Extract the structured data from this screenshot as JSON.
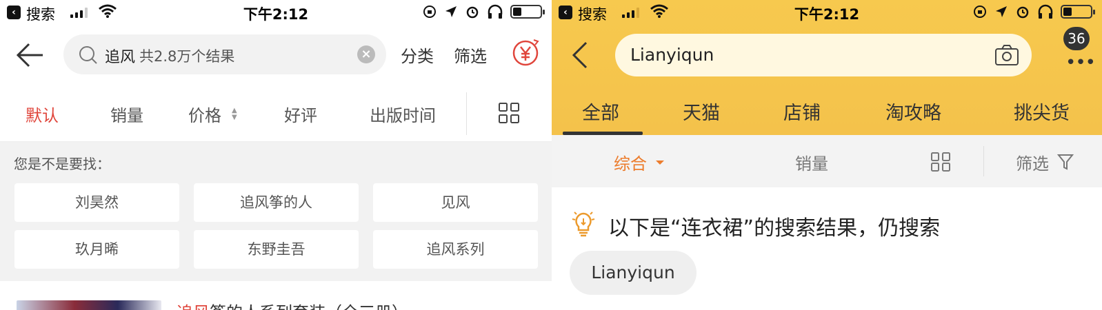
{
  "left": {
    "status_bar": {
      "carrier": "搜索",
      "time": "下午2:12"
    },
    "search": {
      "query": "追风",
      "count_text": "共2.8万个结果",
      "clear_icon": "clear-icon"
    },
    "header_actions": {
      "category": "分类",
      "filter": "筛选",
      "coupon_icon": "yen-coupon-icon"
    },
    "sort_tabs": [
      {
        "label": "默认",
        "active": true
      },
      {
        "label": "销量",
        "active": false
      },
      {
        "label": "价格",
        "active": false
      },
      {
        "label": "好评",
        "active": false
      },
      {
        "label": "出版时间",
        "active": false
      }
    ],
    "suggestions": {
      "hint": "您是不是要找：",
      "items": [
        "刘昊然",
        "追风筝的人",
        "见风",
        "玖月晞",
        "东野圭吾",
        "追风系列"
      ]
    },
    "result": {
      "highlight": "追风",
      "title_rest": "筝的人系列套装（全三册）"
    },
    "accent_color": "#e0463c"
  },
  "right": {
    "status_bar": {
      "carrier": "搜索",
      "time": "下午2:12"
    },
    "search": {
      "query": "Lianyiqun"
    },
    "message_badge": "36",
    "tabs": [
      "全部",
      "天猫",
      "店铺",
      "淘攻略",
      "挑尖货"
    ],
    "active_tab": "全部",
    "sort": {
      "comprehensive": "综合",
      "sales": "销量",
      "filter": "筛选"
    },
    "notice": {
      "text": "以下是“连衣裙”的搜索结果，仍搜索",
      "keyword": "Lianyiqun"
    },
    "theme_color": "#f4c24b",
    "sort_accent": "#ec7c2c"
  }
}
